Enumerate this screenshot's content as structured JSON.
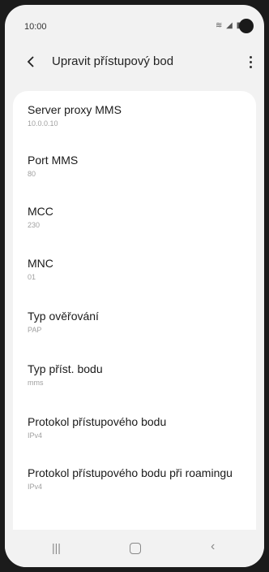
{
  "status": {
    "time": "10:00",
    "icons": [
      "wifi-icon",
      "signal-icon",
      "battery-icon"
    ]
  },
  "header": {
    "back_icon": "chevron-left-icon",
    "title": "Upravit přístupový bod",
    "more_icon": "more-vertical-icon"
  },
  "fields": [
    {
      "label": "Server proxy MMS",
      "value": "10.0.0.10"
    },
    {
      "label": "Port MMS",
      "value": "80"
    },
    {
      "label": "MCC",
      "value": "230"
    },
    {
      "label": "MNC",
      "value": "01"
    },
    {
      "label": "Typ ověřování",
      "value": "PAP"
    },
    {
      "label": "Typ příst. bodu",
      "value": "mms"
    },
    {
      "label": "Protokol přístupového bodu",
      "value": "IPv4"
    },
    {
      "label": "Protokol přístupového bodu při roamingu",
      "value": "IPv4"
    }
  ],
  "navbar": {
    "recent_icon": "recent-apps-icon",
    "home_icon": "home-icon",
    "back_icon": "back-icon"
  }
}
